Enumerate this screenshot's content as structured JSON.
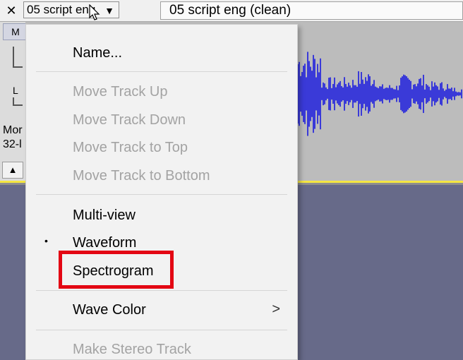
{
  "track": {
    "close_glyph": "✕",
    "name_button_label": "05 script eng",
    "name_button_arrow": "▼",
    "clip_name": "05 script eng (clean)",
    "mute_label": "M",
    "pan_label": "L",
    "info_line_1": "Mor",
    "info_line_2": "32-l",
    "collapse_glyph": "▲",
    "waveform_color": "#3a3ad8",
    "selection_color": "#f5e642"
  },
  "menu": {
    "items": [
      {
        "label": "Name...",
        "enabled": true
      },
      {
        "label": "Move Track Up",
        "enabled": false
      },
      {
        "label": "Move Track Down",
        "enabled": false
      },
      {
        "label": "Move Track to Top",
        "enabled": false
      },
      {
        "label": "Move Track to Bottom",
        "enabled": false
      },
      {
        "label": "Multi-view",
        "enabled": true
      },
      {
        "label": "Waveform",
        "enabled": true,
        "checked": true
      },
      {
        "label": "Spectrogram",
        "enabled": true,
        "highlighted": true
      },
      {
        "label": "Wave Color",
        "enabled": true,
        "submenu": true
      },
      {
        "label": "Make Stereo Track",
        "enabled": false
      }
    ],
    "bullet_glyph": "•",
    "submenu_glyph": ">",
    "highlight_color": "#e30613"
  }
}
